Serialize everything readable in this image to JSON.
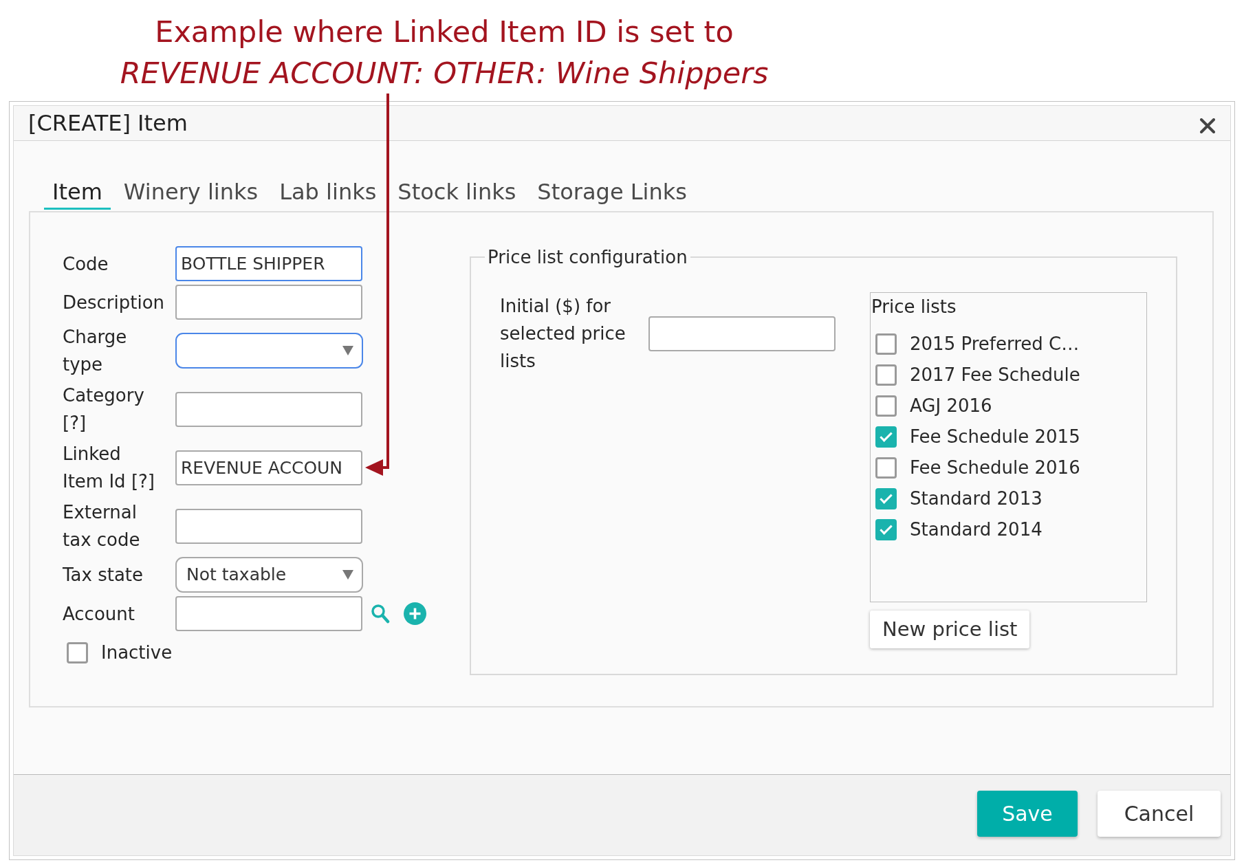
{
  "annotation": {
    "text": "Example where Linked Item ID is set to *REVENUE ACCOUNT: OTHER: Wine Shippers*"
  },
  "dialog": {
    "title": "[CREATE] Item"
  },
  "tabs": [
    {
      "label": "Item",
      "selected": true
    },
    {
      "label": "Winery links",
      "selected": false
    },
    {
      "label": "Lab links",
      "selected": false
    },
    {
      "label": "Stock links",
      "selected": false
    },
    {
      "label": "Storage Links",
      "selected": false
    }
  ],
  "form": {
    "fields": [
      {
        "kind": "input",
        "label": "Code",
        "value": "BOTTLE SHIPPER",
        "highlighted": true,
        "annotated": false
      },
      {
        "kind": "input",
        "label": "Description",
        "highlighted": false,
        "annotated": false
      },
      {
        "kind": "select",
        "label": "Charge type",
        "highlighted": true,
        "annotated": false
      },
      {
        "kind": "input",
        "label": "Category [?]",
        "highlighted": false,
        "annotated": false
      },
      {
        "kind": "input",
        "label": "Linked Item Id [?]",
        "value": "REVENUE ACCOUN",
        "highlighted": false,
        "annotated": true
      },
      {
        "kind": "input",
        "label": "External tax code",
        "highlighted": false,
        "annotated": false
      },
      {
        "kind": "select",
        "label": "Tax state",
        "value": "Not taxable",
        "highlighted": false,
        "annotated": false
      },
      {
        "kind": "lookup",
        "label": "Account",
        "highlighted": false,
        "annotated": false
      }
    ],
    "inactive": {
      "label": "Inactive",
      "checked": false
    }
  },
  "price_list_configuration": {
    "legend": "Price list configuration",
    "initial_label": "Initial ($) for selected price lists",
    "price_lists": {
      "title": "Price lists",
      "items": [
        {
          "name": "2015 Preferred C…",
          "checked": false
        },
        {
          "name": "2017 Fee Schedule",
          "checked": false
        },
        {
          "name": "AGJ 2016",
          "checked": false
        },
        {
          "name": "Fee Schedule 2015",
          "checked": true
        },
        {
          "name": "Fee Schedule 2016",
          "checked": false
        },
        {
          "name": "Standard 2013",
          "checked": true
        },
        {
          "name": "Standard 2014",
          "checked": true
        }
      ]
    },
    "new_button": "New price list"
  },
  "footer": {
    "buttons": [
      {
        "kind": "save",
        "label": "Save"
      },
      {
        "kind": "cancel",
        "label": "Cancel"
      }
    ]
  }
}
